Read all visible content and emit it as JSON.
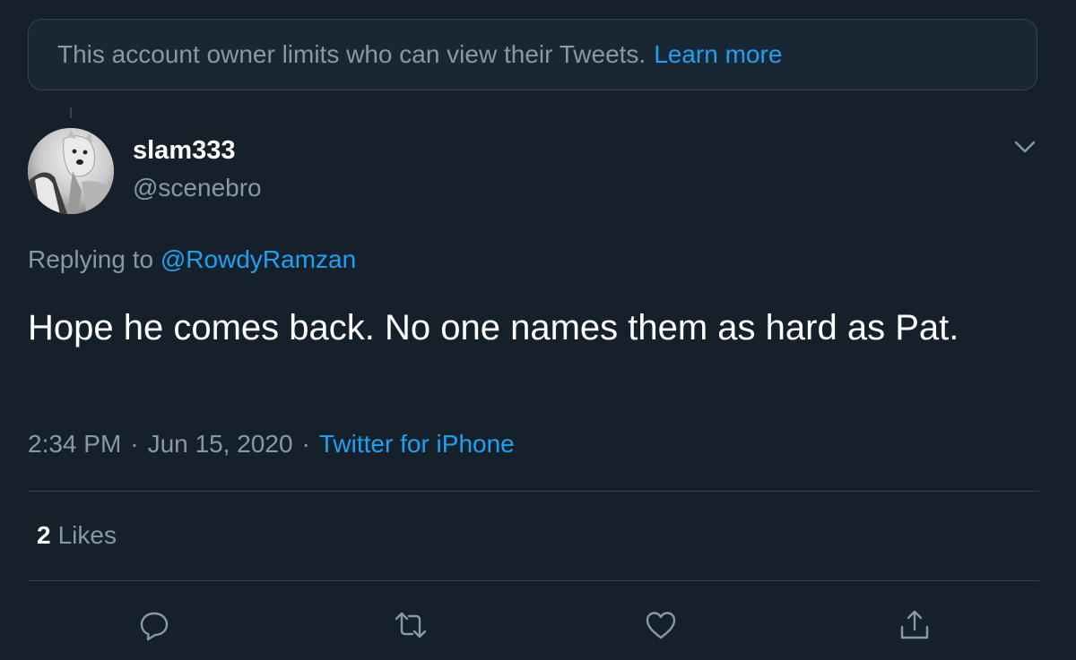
{
  "notice": {
    "text": "This account owner limits who can view their Tweets.",
    "link_label": "Learn more"
  },
  "author": {
    "name": "slam333",
    "handle": "@scenebro"
  },
  "replying": {
    "prefix": "Replying to",
    "mention": "@RowdyRamzan"
  },
  "tweet": {
    "text": "Hope he comes back. No one names them as hard as Pat."
  },
  "meta": {
    "time": "2:34 PM",
    "separator": "·",
    "date": "Jun 15, 2020",
    "source": "Twitter for iPhone"
  },
  "stats": {
    "likes_count": "2",
    "likes_label": "Likes"
  },
  "actions": [
    "reply-icon",
    "retweet-icon",
    "like-icon",
    "share-icon"
  ],
  "colors": {
    "background": "#15202b",
    "accent": "#1da1f2",
    "secondary_text": "#8899a6",
    "border": "#38444d"
  }
}
